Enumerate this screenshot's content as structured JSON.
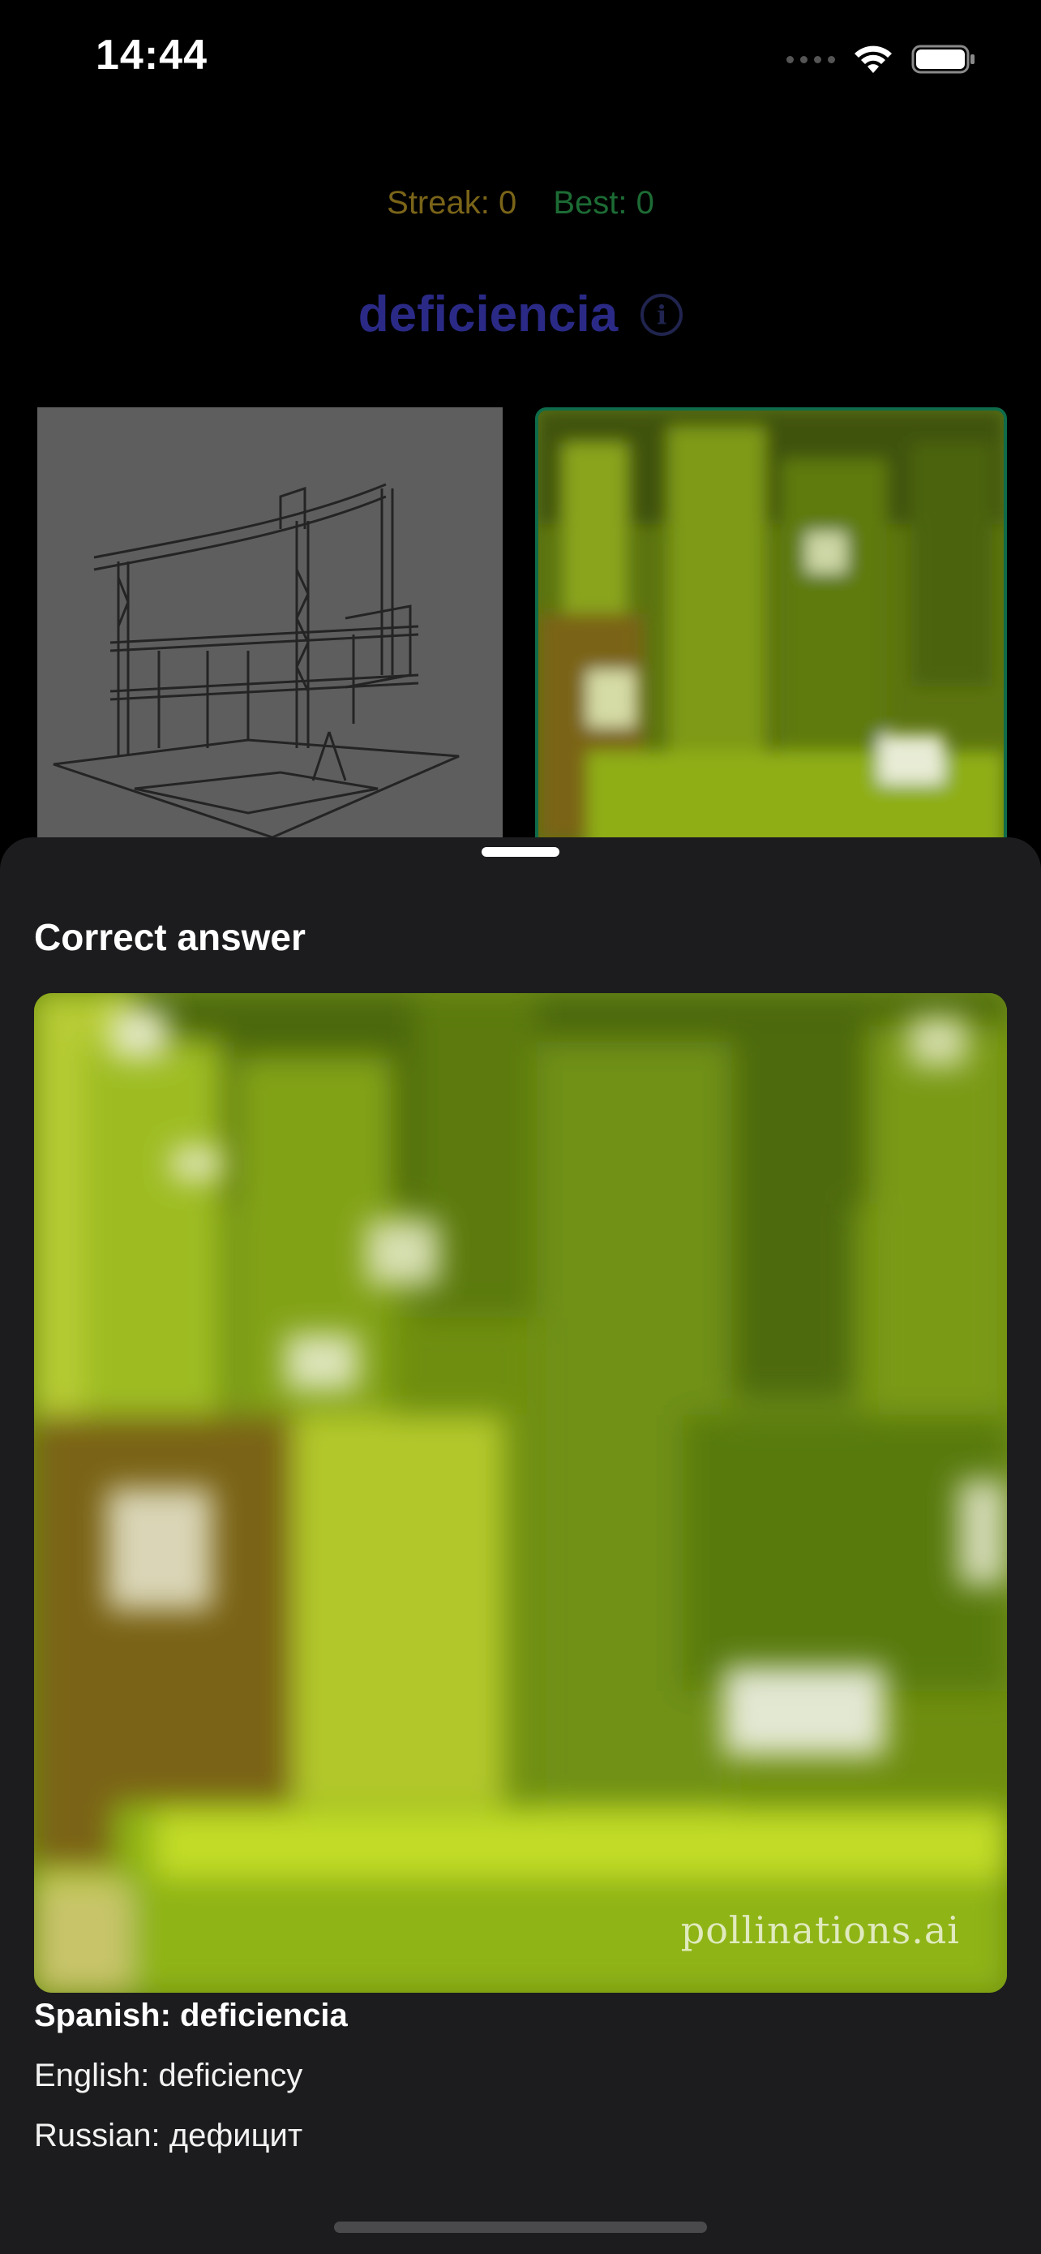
{
  "status_bar": {
    "time": "14:44",
    "icons": [
      "signal-dots-icon",
      "wifi-icon",
      "battery-icon"
    ]
  },
  "game": {
    "streak_label": "Streak: 0",
    "best_label": "Best: 0",
    "word": "deficiencia",
    "info_icon_glyph": "i",
    "options": [
      {
        "name": "option-image-construction-sketch",
        "selected": false
      },
      {
        "name": "option-image-green-blur",
        "selected": true
      }
    ]
  },
  "sheet": {
    "title": "Correct answer",
    "image_watermark": "pollinations.ai",
    "translations": {
      "spanish": "Spanish: deficiencia",
      "english": "English: deficiency",
      "russian": "Russian: дефицит"
    }
  },
  "colors": {
    "streak": "#7a6418",
    "best": "#1c6b34",
    "word": "#2a2a86",
    "selected_border": "#0f6b4a",
    "sheet_bg": "#1c1c1e"
  }
}
